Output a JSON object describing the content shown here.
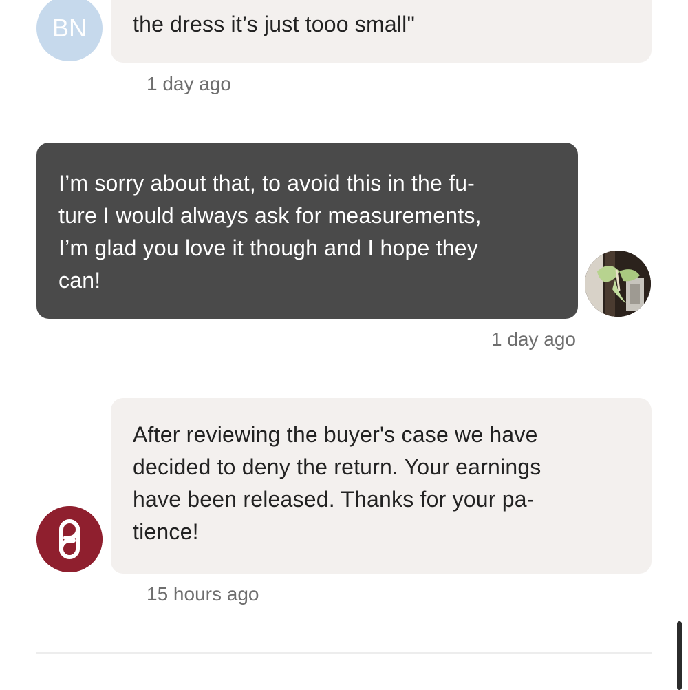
{
  "messages": [
    {
      "sender": "BN",
      "direction": "incoming",
      "text": "the dress it’s just tooo small\"",
      "time": "1 day ago"
    },
    {
      "direction": "outgoing",
      "text": "I’m sorry about that, to avoid this in the fu-\nture I would always ask for measurements,\nI’m glad you love it though and I hope they\ncan!",
      "time": "1 day ago"
    },
    {
      "direction": "incoming",
      "text": "After reviewing the buyer's case we have\ndecided to deny the return. Your earnings\nhave been released. Thanks for your pa-\ntience!",
      "time": "15 hours ago"
    }
  ],
  "avatars": {
    "bn_initials": "BN",
    "bn_color": "#c6d9ec",
    "self_photo_icon": "luna-moth-photo",
    "brand_logo_icon": "poshmark-logo",
    "brand_color": "#8f1f2e"
  },
  "colors": {
    "incoming_bubble": "#f3f0ee",
    "outgoing_bubble": "#4a4a4a",
    "timestamp_text": "#6e6e6e"
  }
}
